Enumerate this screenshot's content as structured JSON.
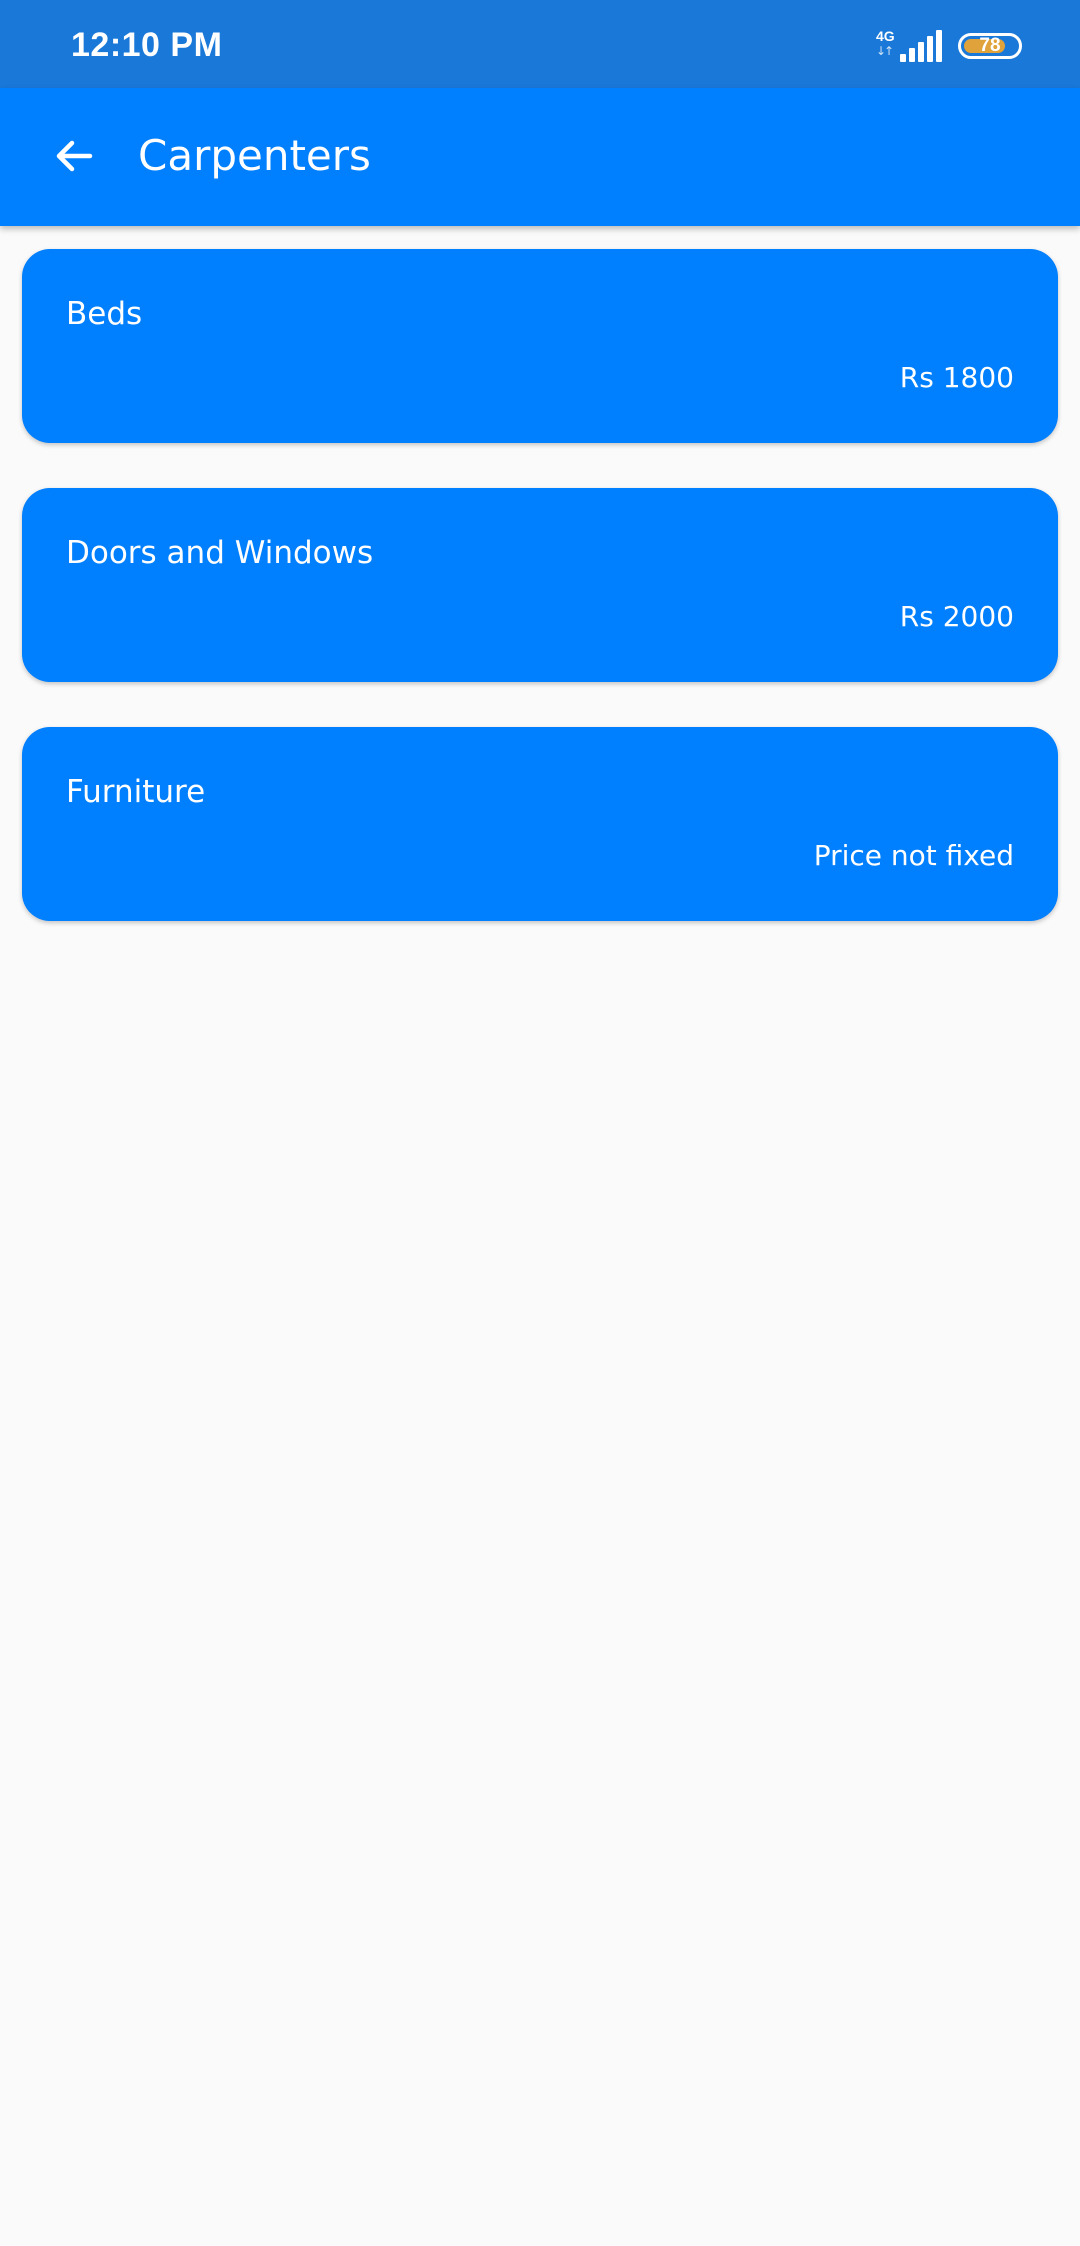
{
  "status_bar": {
    "time": "12:10 PM",
    "network_type": "4G",
    "network_arrows": "↓↑",
    "signal_icon": "signal-bars-icon",
    "battery_level": "78",
    "battery_fraction": 0.78,
    "battery_color": "#e0a23a"
  },
  "app_bar": {
    "title": "Carpenters",
    "back_icon": "arrow-back-icon",
    "color": "#007ffe"
  },
  "services": [
    {
      "name": "Beds",
      "price": "Rs 1800"
    },
    {
      "name": "Doors and Windows",
      "price": "Rs 2000"
    },
    {
      "name": "Furniture",
      "price": "Price not fixed"
    }
  ]
}
